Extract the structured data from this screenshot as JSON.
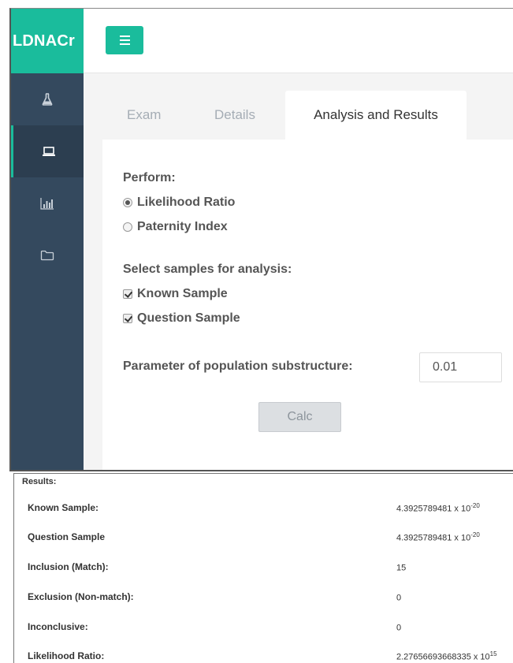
{
  "app": {
    "brand": "LDNACr"
  },
  "sidebar": {
    "items": [
      {
        "icon": "flask-icon",
        "active": false
      },
      {
        "icon": "laptop-icon",
        "active": true
      },
      {
        "icon": "bar-chart-icon",
        "active": false
      },
      {
        "icon": "folder-icon",
        "active": false
      }
    ]
  },
  "header": {
    "menu_icon": "hamburger-icon"
  },
  "tabs": [
    {
      "label": "Exam",
      "active": false
    },
    {
      "label": "Details",
      "active": false
    },
    {
      "label": "Analysis and Results",
      "active": true
    }
  ],
  "form": {
    "perform_label": "Perform:",
    "perform_options": [
      {
        "label": "Likelihood Ratio",
        "selected": true
      },
      {
        "label": "Paternity Index",
        "selected": false
      }
    ],
    "samples_label": "Select samples for analysis:",
    "sample_options": [
      {
        "label": "Known Sample",
        "checked": true
      },
      {
        "label": "Question Sample",
        "checked": true
      }
    ],
    "param_label": "Parameter of population substructure:",
    "param_value": "0.01",
    "calc_label": "Calc"
  },
  "results": {
    "title": "Results:",
    "rows": [
      {
        "label": "Known Sample:",
        "value": "4.3925789481 x 10",
        "exponent": "-20"
      },
      {
        "label": "Question Sample",
        "value": "4.3925789481 x 10",
        "exponent": "-20"
      },
      {
        "label": "Inclusion (Match):",
        "value": "15",
        "exponent": ""
      },
      {
        "label": "Exclusion (Non-match):",
        "value": "0",
        "exponent": ""
      },
      {
        "label": "Inconclusive:",
        "value": "0",
        "exponent": ""
      },
      {
        "label": "Likelihood Ratio:",
        "value": "2.27656693668335 x 10",
        "exponent": "15"
      }
    ]
  }
}
